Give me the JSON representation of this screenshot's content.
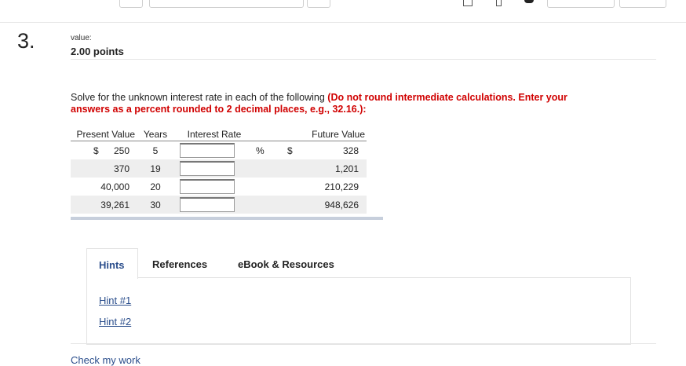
{
  "question": {
    "number": "3.",
    "value_label": "value:",
    "points": "2.00 points"
  },
  "instructions": {
    "text": "Solve for the unknown interest rate in each of the following ",
    "emphasis": "(Do not round intermediate calculations. Enter your answers as a percent rounded to 2 decimal places, e.g., 32.16.):"
  },
  "table": {
    "headers": {
      "present_value": "Present Value",
      "years": "Years",
      "interest_rate": "Interest Rate",
      "future_value": "Future Value"
    },
    "currency_symbol": "$",
    "percent_symbol": "%",
    "rows": [
      {
        "present_value": "250",
        "years": "5",
        "interest_rate": "",
        "future_value": "328"
      },
      {
        "present_value": "370",
        "years": "19",
        "interest_rate": "",
        "future_value": "1,201"
      },
      {
        "present_value": "40,000",
        "years": "20",
        "interest_rate": "",
        "future_value": "210,229"
      },
      {
        "present_value": "39,261",
        "years": "30",
        "interest_rate": "",
        "future_value": "948,626"
      }
    ]
  },
  "tabs": {
    "hints": "Hints",
    "references": "References",
    "ebook": "eBook & Resources"
  },
  "hint_links": [
    "Hint #1",
    "Hint #2"
  ],
  "check_my_work": "Check my work",
  "colors": {
    "accent_red": "#d00000",
    "link_blue": "#2b4e8c",
    "row_shade": "#eeeeee"
  }
}
